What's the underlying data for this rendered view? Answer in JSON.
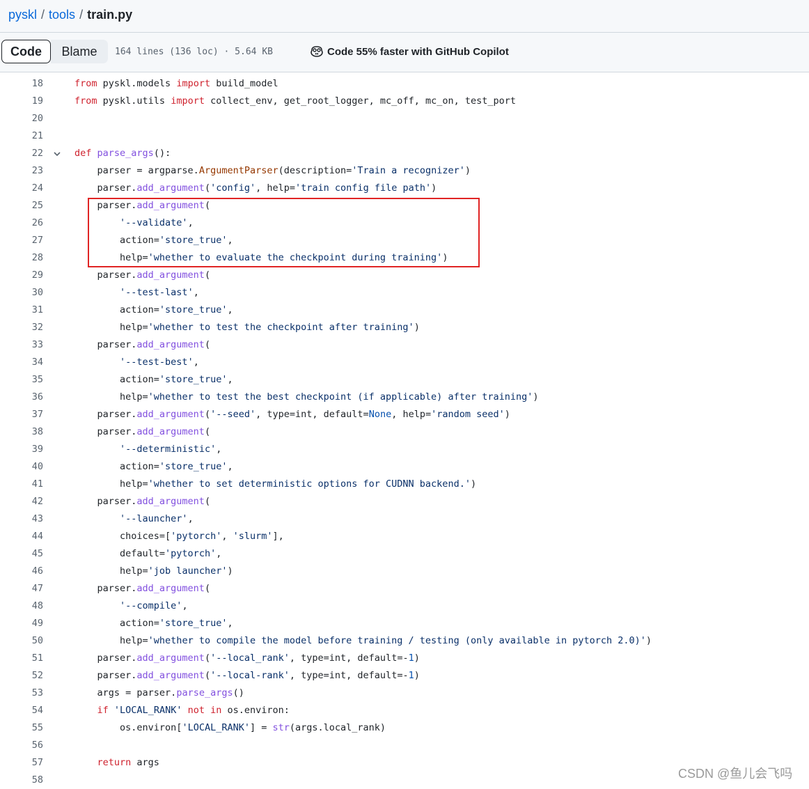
{
  "breadcrumb": {
    "repo": "pyskl",
    "folder": "tools",
    "file": "train.py",
    "separator": "/"
  },
  "toolbar": {
    "code_label": "Code",
    "blame_label": "Blame",
    "file_info": "164 lines (136 loc) · 5.64 KB",
    "copilot_text": "Code 55% faster with GitHub Copilot",
    "copilot_icon": "copilot-icon"
  },
  "code_lines": [
    {
      "n": 18,
      "tokens": [
        [
          "kw",
          "from"
        ],
        [
          "p",
          " pyskl.models "
        ],
        [
          "kw",
          "import"
        ],
        [
          "p",
          " build_model"
        ]
      ]
    },
    {
      "n": 19,
      "tokens": [
        [
          "kw",
          "from"
        ],
        [
          "p",
          " pyskl.utils "
        ],
        [
          "kw",
          "import"
        ],
        [
          "p",
          " collect_env, get_root_logger, mc_off, mc_on, test_port"
        ]
      ]
    },
    {
      "n": 20,
      "tokens": []
    },
    {
      "n": 21,
      "tokens": []
    },
    {
      "n": 22,
      "fold": true,
      "tokens": [
        [
          "kw",
          "def"
        ],
        [
          "p",
          " "
        ],
        [
          "fn",
          "parse_args"
        ],
        [
          "p",
          "():"
        ]
      ]
    },
    {
      "n": 23,
      "tokens": [
        [
          "p",
          "    parser = argparse."
        ],
        [
          "cls",
          "ArgumentParser"
        ],
        [
          "p",
          "(description="
        ],
        [
          "st",
          "'Train a recognizer'"
        ],
        [
          "p",
          ")"
        ]
      ]
    },
    {
      "n": 24,
      "tokens": [
        [
          "p",
          "    parser."
        ],
        [
          "fn",
          "add_argument"
        ],
        [
          "p",
          "("
        ],
        [
          "st",
          "'config'"
        ],
        [
          "p",
          ", help="
        ],
        [
          "st",
          "'train config file path'"
        ],
        [
          "p",
          ")"
        ]
      ]
    },
    {
      "n": 25,
      "tokens": [
        [
          "p",
          "    parser."
        ],
        [
          "fn",
          "add_argument"
        ],
        [
          "p",
          "("
        ]
      ]
    },
    {
      "n": 26,
      "tokens": [
        [
          "p",
          "        "
        ],
        [
          "st",
          "'--validate'"
        ],
        [
          "p",
          ","
        ]
      ]
    },
    {
      "n": 27,
      "tokens": [
        [
          "p",
          "        action="
        ],
        [
          "st",
          "'store_true'"
        ],
        [
          "p",
          ","
        ]
      ]
    },
    {
      "n": 28,
      "tokens": [
        [
          "p",
          "        help="
        ],
        [
          "st",
          "'whether to evaluate the checkpoint during training'"
        ],
        [
          "p",
          ")"
        ]
      ]
    },
    {
      "n": 29,
      "tokens": [
        [
          "p",
          "    parser."
        ],
        [
          "fn",
          "add_argument"
        ],
        [
          "p",
          "("
        ]
      ]
    },
    {
      "n": 30,
      "tokens": [
        [
          "p",
          "        "
        ],
        [
          "st",
          "'--test-last'"
        ],
        [
          "p",
          ","
        ]
      ]
    },
    {
      "n": 31,
      "tokens": [
        [
          "p",
          "        action="
        ],
        [
          "st",
          "'store_true'"
        ],
        [
          "p",
          ","
        ]
      ]
    },
    {
      "n": 32,
      "tokens": [
        [
          "p",
          "        help="
        ],
        [
          "st",
          "'whether to test the checkpoint after training'"
        ],
        [
          "p",
          ")"
        ]
      ]
    },
    {
      "n": 33,
      "tokens": [
        [
          "p",
          "    parser."
        ],
        [
          "fn",
          "add_argument"
        ],
        [
          "p",
          "("
        ]
      ]
    },
    {
      "n": 34,
      "tokens": [
        [
          "p",
          "        "
        ],
        [
          "st",
          "'--test-best'"
        ],
        [
          "p",
          ","
        ]
      ]
    },
    {
      "n": 35,
      "tokens": [
        [
          "p",
          "        action="
        ],
        [
          "st",
          "'store_true'"
        ],
        [
          "p",
          ","
        ]
      ]
    },
    {
      "n": 36,
      "tokens": [
        [
          "p",
          "        help="
        ],
        [
          "st",
          "'whether to test the best checkpoint (if applicable) after training'"
        ],
        [
          "p",
          ")"
        ]
      ]
    },
    {
      "n": 37,
      "tokens": [
        [
          "p",
          "    parser."
        ],
        [
          "fn",
          "add_argument"
        ],
        [
          "p",
          "("
        ],
        [
          "st",
          "'--seed'"
        ],
        [
          "p",
          ", type=int, default="
        ],
        [
          "at",
          "None"
        ],
        [
          "p",
          ", help="
        ],
        [
          "st",
          "'random seed'"
        ],
        [
          "p",
          ")"
        ]
      ]
    },
    {
      "n": 38,
      "tokens": [
        [
          "p",
          "    parser."
        ],
        [
          "fn",
          "add_argument"
        ],
        [
          "p",
          "("
        ]
      ]
    },
    {
      "n": 39,
      "tokens": [
        [
          "p",
          "        "
        ],
        [
          "st",
          "'--deterministic'"
        ],
        [
          "p",
          ","
        ]
      ]
    },
    {
      "n": 40,
      "tokens": [
        [
          "p",
          "        action="
        ],
        [
          "st",
          "'store_true'"
        ],
        [
          "p",
          ","
        ]
      ]
    },
    {
      "n": 41,
      "tokens": [
        [
          "p",
          "        help="
        ],
        [
          "st",
          "'whether to set deterministic options for CUDNN backend.'"
        ],
        [
          "p",
          ")"
        ]
      ]
    },
    {
      "n": 42,
      "tokens": [
        [
          "p",
          "    parser."
        ],
        [
          "fn",
          "add_argument"
        ],
        [
          "p",
          "("
        ]
      ]
    },
    {
      "n": 43,
      "tokens": [
        [
          "p",
          "        "
        ],
        [
          "st",
          "'--launcher'"
        ],
        [
          "p",
          ","
        ]
      ]
    },
    {
      "n": 44,
      "tokens": [
        [
          "p",
          "        choices=["
        ],
        [
          "st",
          "'pytorch'"
        ],
        [
          "p",
          ", "
        ],
        [
          "st",
          "'slurm'"
        ],
        [
          "p",
          "],"
        ]
      ]
    },
    {
      "n": 45,
      "tokens": [
        [
          "p",
          "        default="
        ],
        [
          "st",
          "'pytorch'"
        ],
        [
          "p",
          ","
        ]
      ]
    },
    {
      "n": 46,
      "tokens": [
        [
          "p",
          "        help="
        ],
        [
          "st",
          "'job launcher'"
        ],
        [
          "p",
          ")"
        ]
      ]
    },
    {
      "n": 47,
      "tokens": [
        [
          "p",
          "    parser."
        ],
        [
          "fn",
          "add_argument"
        ],
        [
          "p",
          "("
        ]
      ]
    },
    {
      "n": 48,
      "tokens": [
        [
          "p",
          "        "
        ],
        [
          "st",
          "'--compile'"
        ],
        [
          "p",
          ","
        ]
      ]
    },
    {
      "n": 49,
      "tokens": [
        [
          "p",
          "        action="
        ],
        [
          "st",
          "'store_true'"
        ],
        [
          "p",
          ","
        ]
      ]
    },
    {
      "n": 50,
      "tokens": [
        [
          "p",
          "        help="
        ],
        [
          "st",
          "'whether to compile the model before training / testing (only available in pytorch 2.0)'"
        ],
        [
          "p",
          ")"
        ]
      ]
    },
    {
      "n": 51,
      "tokens": [
        [
          "p",
          "    parser."
        ],
        [
          "fn",
          "add_argument"
        ],
        [
          "p",
          "("
        ],
        [
          "st",
          "'--local_rank'"
        ],
        [
          "p",
          ", type=int, default=-"
        ],
        [
          "at",
          "1"
        ],
        [
          "p",
          ")"
        ]
      ]
    },
    {
      "n": 52,
      "tokens": [
        [
          "p",
          "    parser."
        ],
        [
          "fn",
          "add_argument"
        ],
        [
          "p",
          "("
        ],
        [
          "st",
          "'--local-rank'"
        ],
        [
          "p",
          ", type=int, default=-"
        ],
        [
          "at",
          "1"
        ],
        [
          "p",
          ")"
        ]
      ]
    },
    {
      "n": 53,
      "tokens": [
        [
          "p",
          "    args = parser."
        ],
        [
          "fn",
          "parse_args"
        ],
        [
          "p",
          "()"
        ]
      ]
    },
    {
      "n": 54,
      "tokens": [
        [
          "p",
          "    "
        ],
        [
          "kw",
          "if"
        ],
        [
          "p",
          " "
        ],
        [
          "st",
          "'LOCAL_RANK'"
        ],
        [
          "p",
          " "
        ],
        [
          "kw",
          "not in"
        ],
        [
          "p",
          " os.environ:"
        ]
      ]
    },
    {
      "n": 55,
      "tokens": [
        [
          "p",
          "        os.environ["
        ],
        [
          "st",
          "'LOCAL_RANK'"
        ],
        [
          "p",
          "] = "
        ],
        [
          "fn",
          "str"
        ],
        [
          "p",
          "(args.local_rank)"
        ]
      ]
    },
    {
      "n": 56,
      "tokens": []
    },
    {
      "n": 57,
      "tokens": [
        [
          "p",
          "    "
        ],
        [
          "kw",
          "return"
        ],
        [
          "p",
          " args"
        ]
      ]
    },
    {
      "n": 58,
      "tokens": []
    }
  ],
  "watermark": "CSDN @鱼儿会飞吗",
  "colors": {
    "keyword": "#cf222e",
    "function": "#8250df",
    "class": "#953800",
    "string": "#0a3069",
    "constant": "#0550ae",
    "highlight_border": "#e02424"
  }
}
